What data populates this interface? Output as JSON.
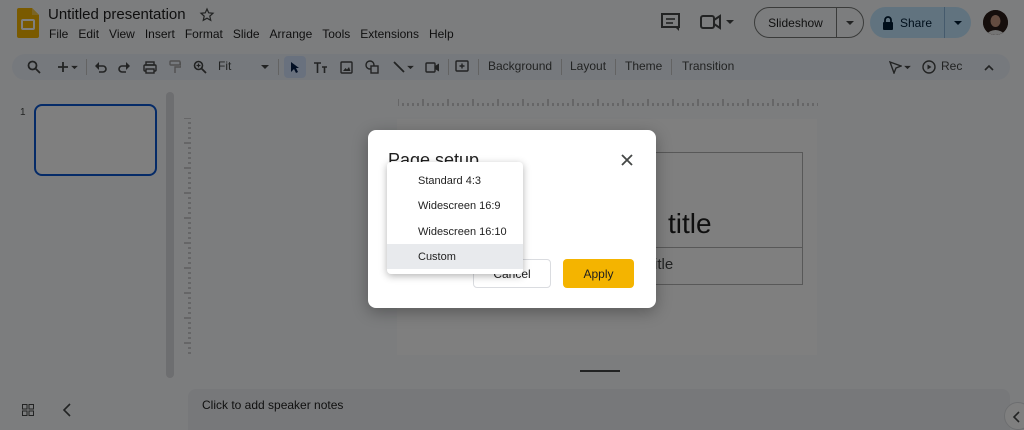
{
  "header": {
    "title": "Untitled presentation",
    "menu": [
      "File",
      "Edit",
      "View",
      "Insert",
      "Format",
      "Slide",
      "Arrange",
      "Tools",
      "Extensions",
      "Help"
    ],
    "slideshow_label": "Slideshow",
    "share_label": "Share"
  },
  "toolbar": {
    "zoom_label": "Fit",
    "background_label": "Background",
    "layout_label": "Layout",
    "theme_label": "Theme",
    "transition_label": "Transition",
    "rec_label": "Rec"
  },
  "filmstrip": {
    "slide_number": "1"
  },
  "slide": {
    "title_placeholder": "title",
    "subtitle_placeholder": "itle"
  },
  "notes": {
    "placeholder": "Click to add speaker notes"
  },
  "dialog": {
    "title": "Page setup",
    "cancel_label": "Cancel",
    "apply_label": "Apply",
    "size_options": [
      "Standard 4:3",
      "Widescreen 16:9",
      "Widescreen 16:10",
      "Custom"
    ],
    "highlighted_option": "Custom"
  },
  "colors": {
    "accent": "#0b57d0",
    "share_bg": "#c2e7ff",
    "apply_bg": "#f4b400",
    "logo": "#f4b400"
  },
  "icons": [
    "slides-logo-icon",
    "star-icon",
    "comments-icon",
    "meet-icon",
    "lock-icon",
    "search-icon",
    "add-icon",
    "undo-icon",
    "redo-icon",
    "print-icon",
    "paint-format-icon",
    "zoom-icon",
    "select-icon",
    "text-box-icon",
    "image-icon",
    "shape-icon",
    "line-icon",
    "video-icon",
    "comment-add-icon",
    "pointer-icon",
    "record-icon",
    "collapse-icon",
    "grid-icon",
    "chevron-left-icon",
    "close-icon"
  ]
}
